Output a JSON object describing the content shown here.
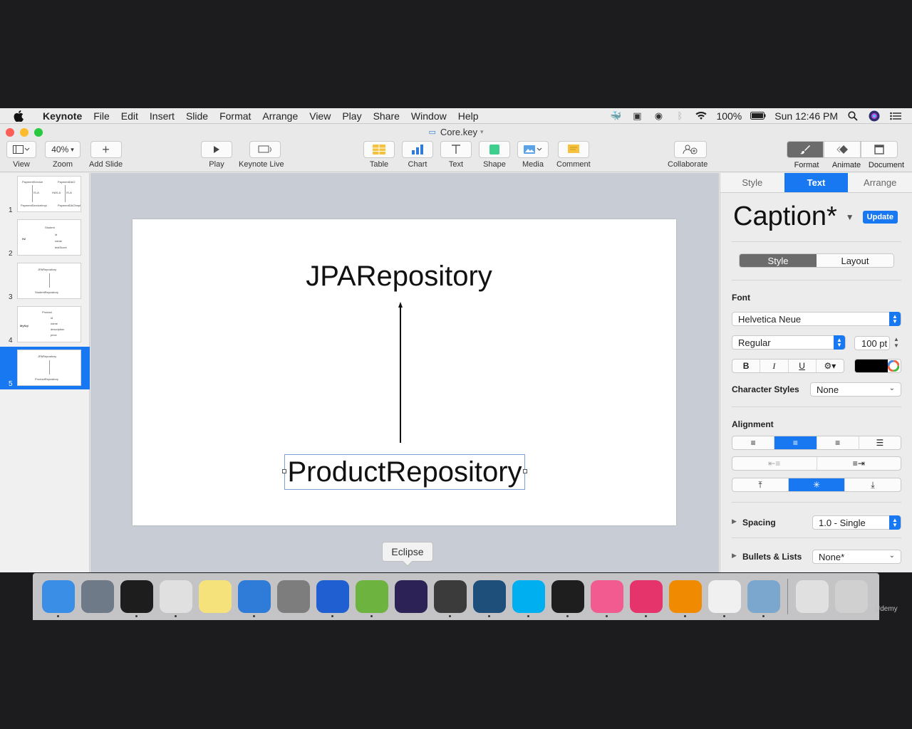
{
  "menubar": {
    "app_name": "Keynote",
    "items": [
      "File",
      "Edit",
      "Insert",
      "Slide",
      "Format",
      "Arrange",
      "View",
      "Play",
      "Share",
      "Window",
      "Help"
    ],
    "battery": "100%",
    "clock": "Sun 12:46 PM"
  },
  "window": {
    "title": "Core.key"
  },
  "toolbar": {
    "view_label": "View",
    "zoom_value": "40%",
    "zoom_label": "Zoom",
    "add_slide_label": "Add Slide",
    "play_label": "Play",
    "keynote_live_label": "Keynote Live",
    "table_label": "Table",
    "chart_label": "Chart",
    "text_label": "Text",
    "shape_label": "Shape",
    "media_label": "Media",
    "comment_label": "Comment",
    "collaborate_label": "Collaborate",
    "format_label": "Format",
    "animate_label": "Animate",
    "document_label": "Document"
  },
  "navigator": {
    "slides": [
      {
        "num": "1",
        "texts": [
          "PaymentService",
          "PaymentDAO",
          "IS-A",
          "HAS-A",
          "IS-A",
          "PaymentServiceImpl",
          "PaymentDAOImpl"
        ]
      },
      {
        "num": "2",
        "texts": [
          "Student",
          "H2",
          "id",
          "name",
          "testScore"
        ]
      },
      {
        "num": "3",
        "texts": [
          "JPARepository",
          "StudentRepository"
        ]
      },
      {
        "num": "4",
        "texts": [
          "Product",
          "MySql",
          "id",
          "name",
          "description",
          "price"
        ]
      },
      {
        "num": "5",
        "texts": [
          "JPARepository",
          "ProductRepository"
        ]
      }
    ],
    "selected_index": 4
  },
  "slide": {
    "title": "JPARepository",
    "caption": "ProductRepository"
  },
  "inspector": {
    "tabs": [
      "Style",
      "Text",
      "Arrange"
    ],
    "active_tab": "Text",
    "paragraph_style": "Caption*",
    "update_label": "Update",
    "subtabs": [
      "Style",
      "Layout"
    ],
    "font_label": "Font",
    "font_family": "Helvetica Neue",
    "font_weight": "Regular",
    "font_size": "100 pt",
    "bold": "B",
    "italic": "I",
    "underline": "U",
    "text_color": "#000000",
    "character_styles_label": "Character Styles",
    "character_styles_value": "None",
    "alignment_label": "Alignment",
    "spacing_label": "Spacing",
    "spacing_value": "1.0 - Single",
    "bullets_label": "Bullets & Lists",
    "bullets_value": "None*"
  },
  "tooltip": {
    "text": "Eclipse"
  },
  "dock": {
    "apps": [
      {
        "icon": "finder-icon",
        "color": "#3a8ee6",
        "running": true
      },
      {
        "icon": "launchpad-icon",
        "color": "#6e7a88",
        "running": false
      },
      {
        "icon": "terminal-icon",
        "color": "#1d1d1d",
        "running": true
      },
      {
        "icon": "chrome-icon",
        "color": "#e0e0e0",
        "running": true
      },
      {
        "icon": "notes-icon",
        "color": "#f6e27a",
        "running": false
      },
      {
        "icon": "keynote-icon",
        "color": "#2f7bd8",
        "running": true
      },
      {
        "icon": "system-preferences-icon",
        "color": "#7d7d7d",
        "running": false
      },
      {
        "icon": "screen-recorder-icon",
        "color": "#1f5fd1",
        "running": true
      },
      {
        "icon": "spring-tool-suite-icon",
        "color": "#6db33f",
        "running": true
      },
      {
        "icon": "eclipse-icon",
        "color": "#2c2255",
        "running": false
      },
      {
        "icon": "sublime-text-icon",
        "color": "#3b3b3b",
        "running": true
      },
      {
        "icon": "mysql-workbench-icon",
        "color": "#1d4f7a",
        "running": true
      },
      {
        "icon": "skype-icon",
        "color": "#00aff0",
        "running": true
      },
      {
        "icon": "vscode-icon",
        "color": "#1e1e1e",
        "running": true
      },
      {
        "icon": "itunes-icon",
        "color": "#f25b8f",
        "running": true
      },
      {
        "icon": "cleanmymac-icon",
        "color": "#e5336b",
        "running": true
      },
      {
        "icon": "vlc-icon",
        "color": "#f08a00",
        "running": true
      },
      {
        "icon": "photos-icon",
        "color": "#f0f0f0",
        "running": true
      },
      {
        "icon": "preview-icon",
        "color": "#7ba7cf",
        "running": true
      }
    ],
    "extras": [
      {
        "icon": "downloads-stack-icon",
        "color": "#e0e0e0"
      },
      {
        "icon": "trash-icon",
        "color": "#d0d0d0"
      }
    ]
  },
  "watermark": "Udemy"
}
